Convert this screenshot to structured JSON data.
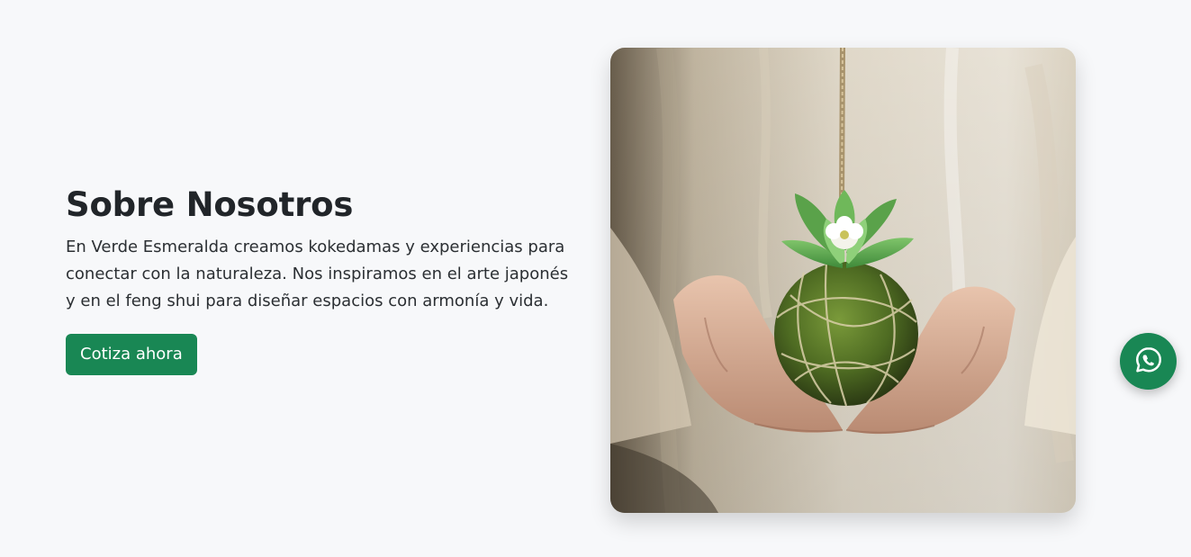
{
  "about": {
    "title": "Sobre Nosotros",
    "description": "En Verde Esmeralda creamos kokedamas y experiencias para conectar con la naturaleza. Nos inspiramos en el arte japonés y en el feng shui para diseñar espacios con armonía y vida.",
    "cta_label": "Cotiza ahora"
  },
  "colors": {
    "accent": "#198754",
    "background": "#f7f8fa",
    "text": "#212529"
  },
  "icons": {
    "floating_button": "whatsapp-icon"
  }
}
